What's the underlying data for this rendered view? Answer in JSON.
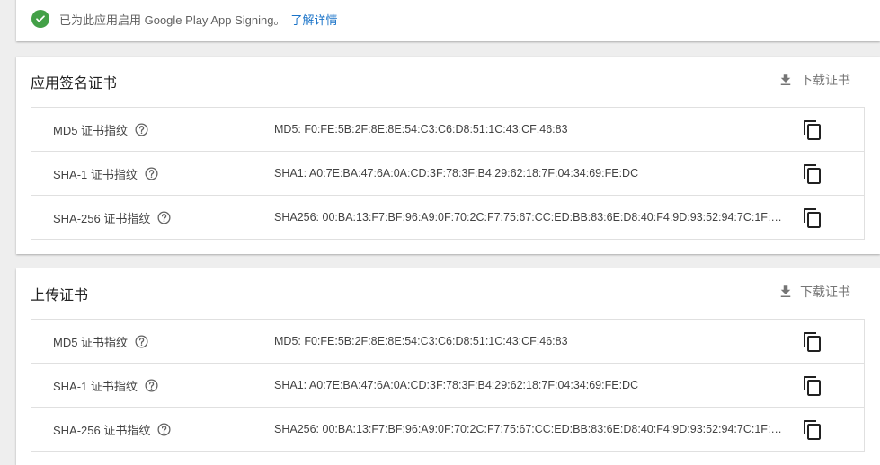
{
  "status": {
    "text": "已为此应用启用 Google Play App Signing。",
    "link_label": "了解详情",
    "colors": {
      "check": "#43a047",
      "link": "#1a73c8"
    }
  },
  "sections": [
    {
      "title": "应用签名证书",
      "download_label": "下载证书",
      "rows": [
        {
          "label": "MD5 证书指纹",
          "value": "MD5: F0:FE:5B:2F:8E:8E:54:C3:C6:D8:51:1C:43:CF:46:83"
        },
        {
          "label": "SHA-1 证书指纹",
          "value": "SHA1: A0:7E:BA:47:6A:0A:CD:3F:78:3F:B4:29:62:18:7F:04:34:69:FE:DC"
        },
        {
          "label": "SHA-256 证书指纹",
          "value": "SHA256: 00:BA:13:F7:BF:96:A9:0F:70:2C:F7:75:67:CC:ED:BB:83:6E:D8:40:F4:9D:93:52:94:7C:1F:D..."
        }
      ]
    },
    {
      "title": "上传证书",
      "download_label": "下载证书",
      "rows": [
        {
          "label": "MD5 证书指纹",
          "value": "MD5: F0:FE:5B:2F:8E:8E:54:C3:C6:D8:51:1C:43:CF:46:83"
        },
        {
          "label": "SHA-1 证书指纹",
          "value": "SHA1: A0:7E:BA:47:6A:0A:CD:3F:78:3F:B4:29:62:18:7F:04:34:69:FE:DC"
        },
        {
          "label": "SHA-256 证书指纹",
          "value": "SHA256: 00:BA:13:F7:BF:96:A9:0F:70:2C:F7:75:67:CC:ED:BB:83:6E:D8:40:F4:9D:93:52:94:7C:1F:D..."
        }
      ]
    }
  ],
  "icons": {
    "status": "check-circle-icon",
    "download": "download-icon",
    "help": "help-icon",
    "copy": "copy-icon"
  }
}
